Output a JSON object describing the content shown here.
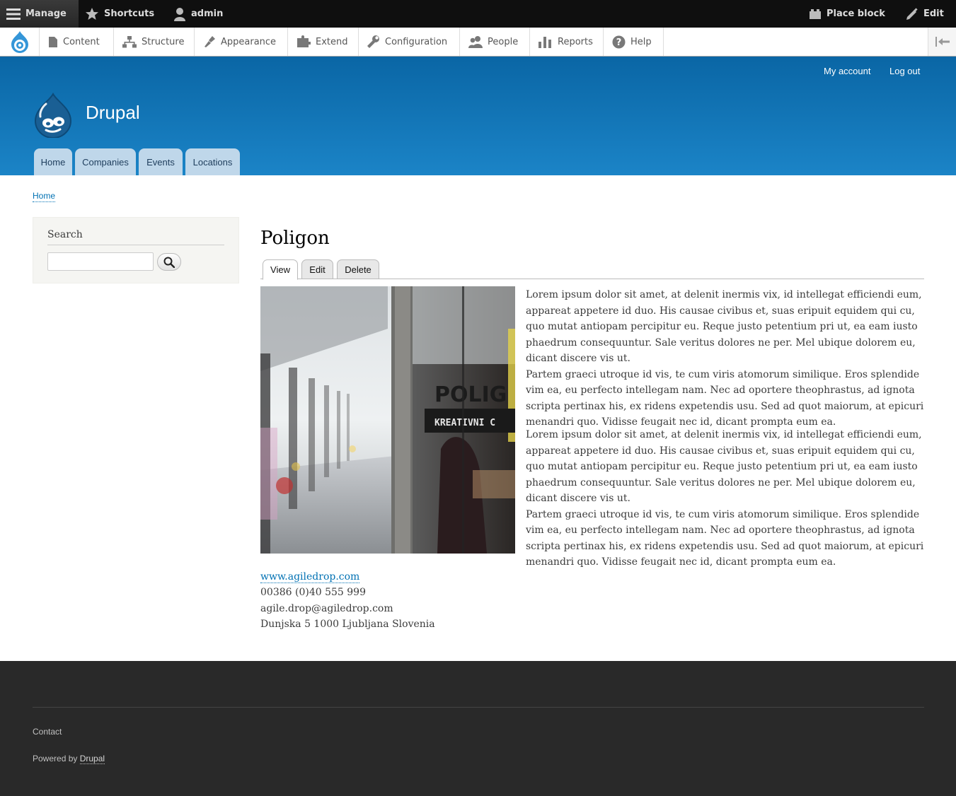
{
  "admin_toolbar": {
    "manage": "Manage",
    "shortcuts": "Shortcuts",
    "user": "admin",
    "place_block": "Place block",
    "edit": "Edit"
  },
  "tray": {
    "items": [
      "Content",
      "Structure",
      "Appearance",
      "Extend",
      "Configuration",
      "People",
      "Reports",
      "Help"
    ]
  },
  "header": {
    "site_name": "Drupal",
    "secondary_menu": [
      "My account",
      "Log out"
    ],
    "main_menu": [
      "Home",
      "Companies",
      "Events",
      "Locations"
    ]
  },
  "breadcrumb": [
    "Home"
  ],
  "sidebar": {
    "search_title": "Search",
    "search_value": ""
  },
  "node": {
    "title": "Poligon",
    "tabs": [
      "View",
      "Edit",
      "Delete"
    ],
    "active_tab": "View",
    "image_sign": [
      "POLIG",
      "KREATIVNI C"
    ],
    "paragraphs": [
      "Lorem ipsum dolor sit amet, at delenit inermis vix, id intellegat efficiendi eum, appareat appetere id duo. His causae civibus et, suas eripuit equidem qui cu, quo mutat antiopam percipitur eu. Reque justo petentium pri ut, ea eam iusto phaedrum consequuntur. Sale veritus dolores ne per. Mel ubique dolorem eu, dicant discere vis ut.",
      "Partem graeci utroque id vis, te cum viris atomorum similique. Eros splendide vim ea, eu perfecto intellegam nam. Nec ad oportere theophrastus, ad ignota scripta pertinax his, ex ridens expetendis usu. Sed ad quot maiorum, at epicuri menandri quo. Vidisse feugait nec id, dicant prompta eum ea.",
      "Lorem ipsum dolor sit amet, at delenit inermis vix, id intellegat efficiendi eum, appareat appetere id duo. His causae civibus et, suas eripuit equidem qui cu, quo mutat antiopam percipitur eu. Reque justo petentium pri ut, ea eam iusto phaedrum consequuntur. Sale veritus dolores ne per. Mel ubique dolorem eu, dicant discere vis ut.",
      "Partem graeci utroque id vis, te cum viris atomorum similique. Eros splendide vim ea, eu perfecto intellegam nam. Nec ad oportere theophrastus, ad ignota scripta pertinax his, ex ridens expetendis usu. Sed ad quot maiorum, at epicuri menandri quo. Vidisse feugait nec id, dicant prompta eum ea."
    ],
    "website": "www.agiledrop.com",
    "phone": "00386 (0)40 555 999",
    "email": "agile.drop@agiledrop.com",
    "address": "Dunjska 5 1000 Ljubljana Slovenia"
  },
  "footer": {
    "contact": "Contact",
    "powered_by": "Powered by",
    "powered_link": "Drupal"
  },
  "colors": {
    "header_top": "#0a66a5",
    "header_bottom": "#1b84c7",
    "link": "#0071b3",
    "footer_bg": "#292929",
    "toolbar_bg": "#0f0f0f"
  }
}
